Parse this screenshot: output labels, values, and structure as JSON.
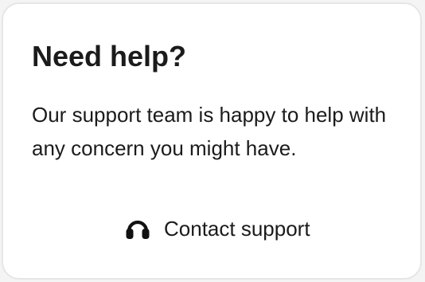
{
  "card": {
    "title": "Need help?",
    "description": "Our support team is happy to help with any concern you might have.",
    "contact": {
      "label": "Contact support",
      "icon": "headset-icon"
    }
  },
  "colors": {
    "text": "#1b1b1b",
    "card_background": "#ffffff",
    "card_border": "#e6e6e6",
    "page_background": "#f4f4f4"
  }
}
